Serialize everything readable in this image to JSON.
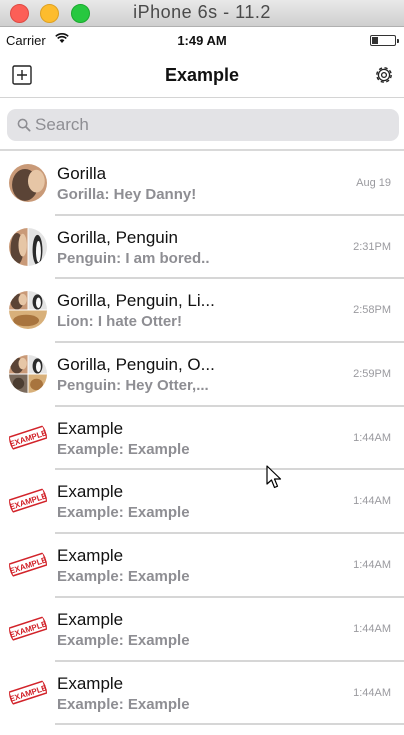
{
  "simulator": {
    "title": "iPhone 6s - 11.2"
  },
  "status": {
    "carrier": "Carrier",
    "time": "1:49 AM"
  },
  "nav": {
    "title": "Example",
    "left_icon": "compose-icon",
    "right_icon": "gear-icon"
  },
  "search": {
    "placeholder": "Search",
    "value": ""
  },
  "conversations": [
    {
      "title": "Gorilla",
      "preview": "Gorilla: Hey Danny!",
      "time": "Aug 19",
      "avatar": "gorilla"
    },
    {
      "title": "Gorilla, Penguin",
      "preview": "Penguin: I am bored..",
      "time": "2:31PM",
      "avatar": "gorilla-penguin"
    },
    {
      "title": "Gorilla, Penguin, Li...",
      "preview": "Lion: I hate Otter!",
      "time": "2:58PM",
      "avatar": "gorilla-penguin-lion"
    },
    {
      "title": "Gorilla, Penguin, O...",
      "preview": "Penguin: Hey Otter,...",
      "time": "2:59PM",
      "avatar": "gorilla-penguin-otter-lion"
    },
    {
      "title": "Example",
      "preview": "Example: Example",
      "time": "1:44AM",
      "avatar": "example-stamp",
      "stamp_text": "EXAMPLE"
    },
    {
      "title": "Example",
      "preview": "Example: Example",
      "time": "1:44AM",
      "avatar": "example-stamp",
      "stamp_text": "EXAMPLE"
    },
    {
      "title": "Example",
      "preview": "Example: Example",
      "time": "1:44AM",
      "avatar": "example-stamp",
      "stamp_text": "EXAMPLE"
    },
    {
      "title": "Example",
      "preview": "Example: Example",
      "time": "1:44AM",
      "avatar": "example-stamp",
      "stamp_text": "EXAMPLE"
    },
    {
      "title": "Example",
      "preview": "Example: Example",
      "time": "1:44AM",
      "avatar": "example-stamp",
      "stamp_text": "EXAMPLE"
    }
  ],
  "colors": {
    "secondary_text": "#8e8e93",
    "separator": "#d6d6d6",
    "stamp_red": "#d2232a",
    "search_bg": "#e3e3e6"
  }
}
